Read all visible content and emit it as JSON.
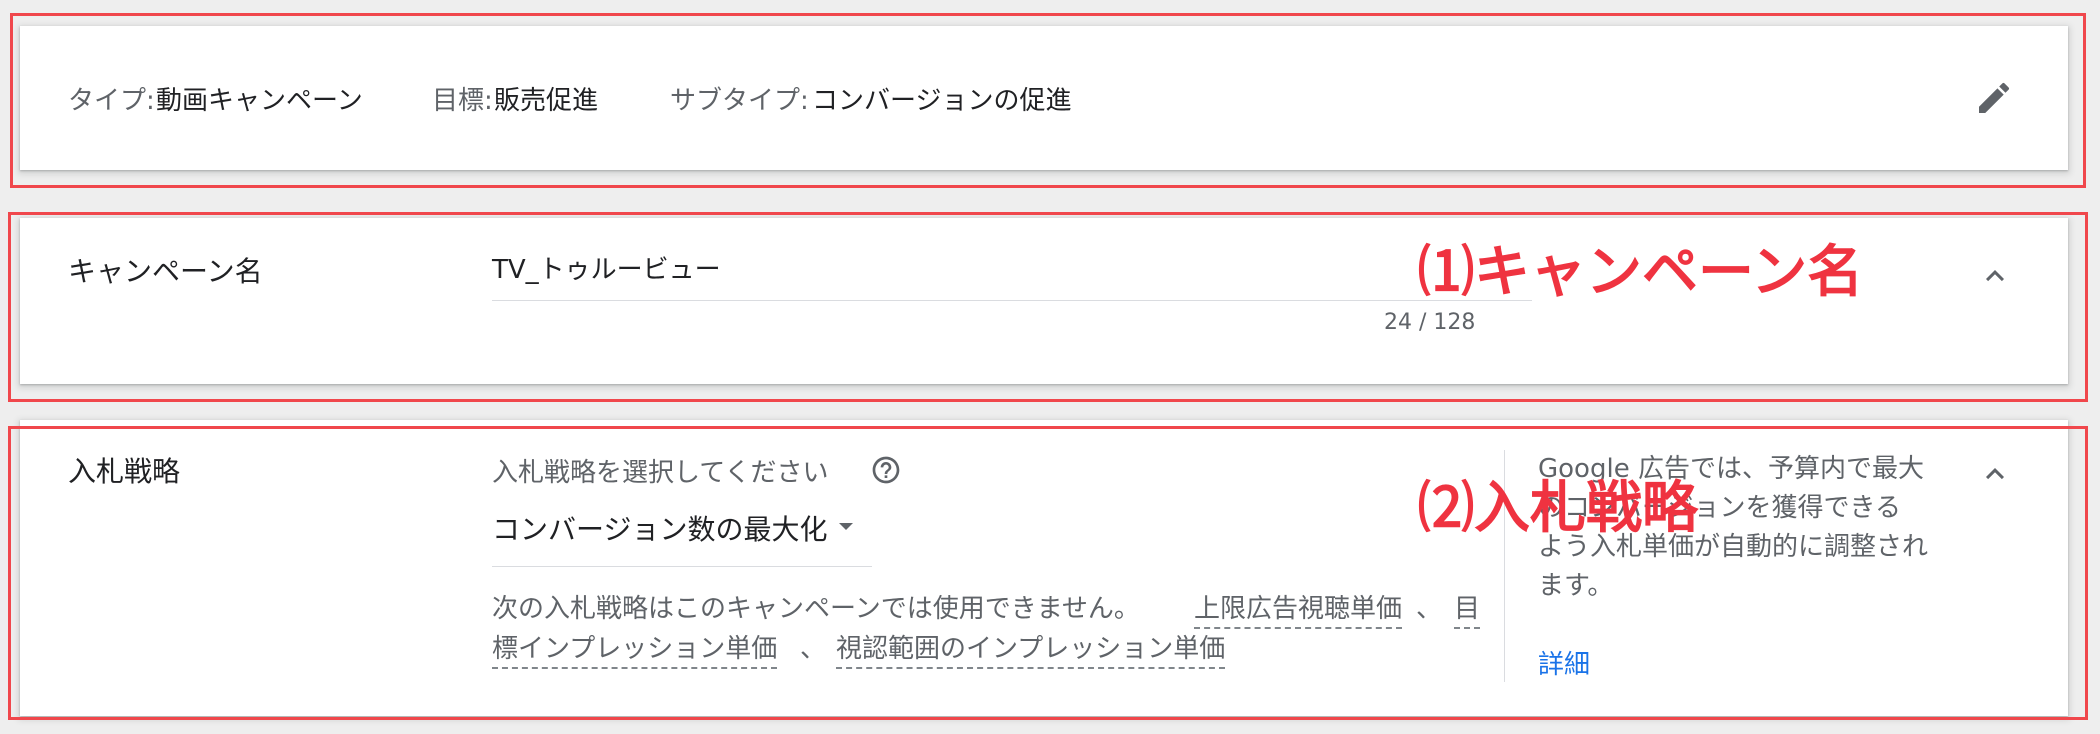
{
  "summary": {
    "type_label": "タイプ:",
    "type_value": "動画キャンペーン",
    "goal_label": "目標:",
    "goal_value": "販売促進",
    "subtype_label": "サブタイプ:",
    "subtype_value": "コンバージョンの促進",
    "edit_icon": "pencil-icon"
  },
  "campaign_name": {
    "label": "キャンペーン名",
    "value": "TV_トゥルービュー",
    "char_count": "24 / 128",
    "collapse_icon": "chevron-up-icon"
  },
  "bidding": {
    "label": "入札戦略",
    "select_prompt": "入札戦略を選択してください",
    "help_icon": "help-circle-icon",
    "selected_value": "コンバージョン数の最大化",
    "dropdown_icon": "caret-down-icon",
    "note_prefix": "次の入札戦略はこのキャンペーンでは使用できません。",
    "note_link1_a": "上限広告視聴単価",
    "note_sep1": "、",
    "note_link2_a": "目",
    "note_link2_b": "標インプレッション単価",
    "note_sep2": "、",
    "note_link3": "視認範囲のインプレッション単価",
    "side_help_1": "Google 広告では、予算内で最大",
    "side_help_2": "のコンバージョンを獲得できる",
    "side_help_3": "よう入札単価が自動的に調整され",
    "side_help_4": "ます。",
    "details_link": "詳細",
    "collapse_icon": "chevron-up-icon"
  },
  "annotations": {
    "one": "⑴キャンペーン名",
    "two": "⑵入札戦略"
  },
  "colors": {
    "highlight": "#f0474c",
    "annotation": "#ef3340",
    "link": "#1a73e8"
  }
}
